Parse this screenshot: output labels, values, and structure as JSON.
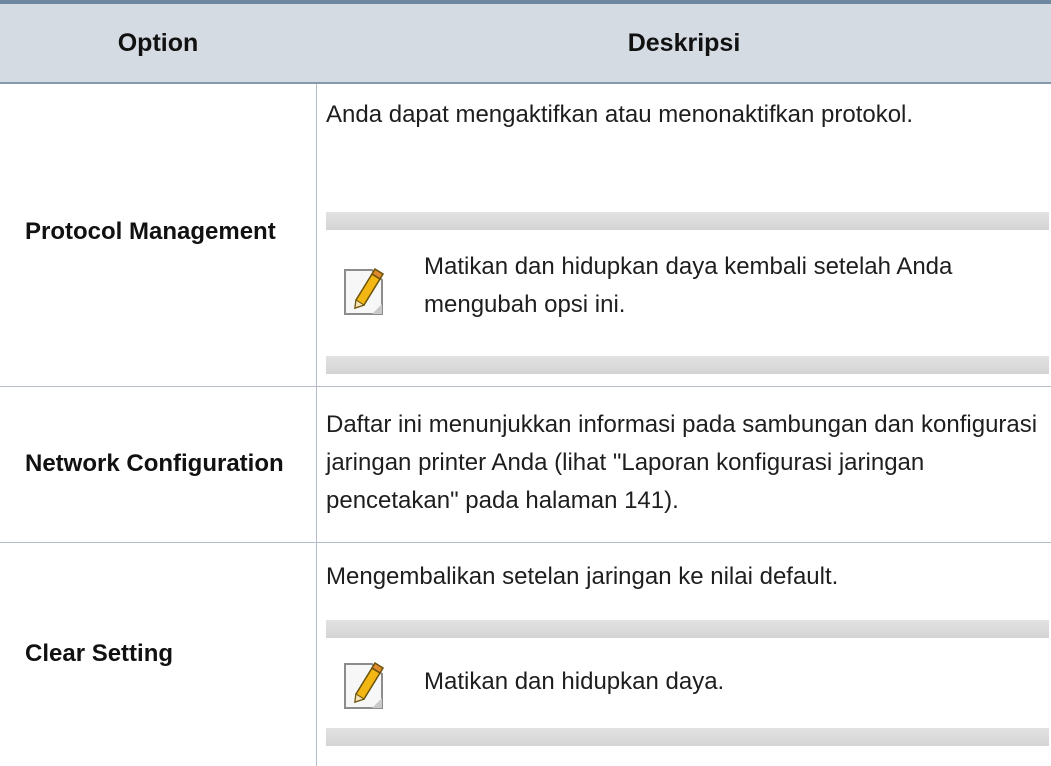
{
  "table": {
    "headers": {
      "option": "Option",
      "description": "Deskripsi"
    },
    "rows": [
      {
        "option": "Protocol Management",
        "description": "Anda dapat mengaktifkan atau menonaktifkan protokol.",
        "note": "Matikan dan hidupkan daya kembali setelah Anda mengubah opsi ini."
      },
      {
        "option": "Network Configuration",
        "description": "Daftar ini menunjukkan informasi pada sambungan dan konfigurasi jaringan printer Anda (lihat \"Laporan konfigurasi jaringan pencetakan\" pada halaman 141)."
      },
      {
        "option": "Clear Setting",
        "description": "Mengembalikan setelan jaringan ke nilai default.",
        "note": "Matikan dan hidupkan daya."
      }
    ]
  },
  "icons": {
    "note": "note-pencil-icon"
  },
  "colors": {
    "header_background": "#d4dbe2",
    "top_rule": "#6e87a0",
    "note_band": "#d8d8d8",
    "pencil": "#f2b713"
  }
}
